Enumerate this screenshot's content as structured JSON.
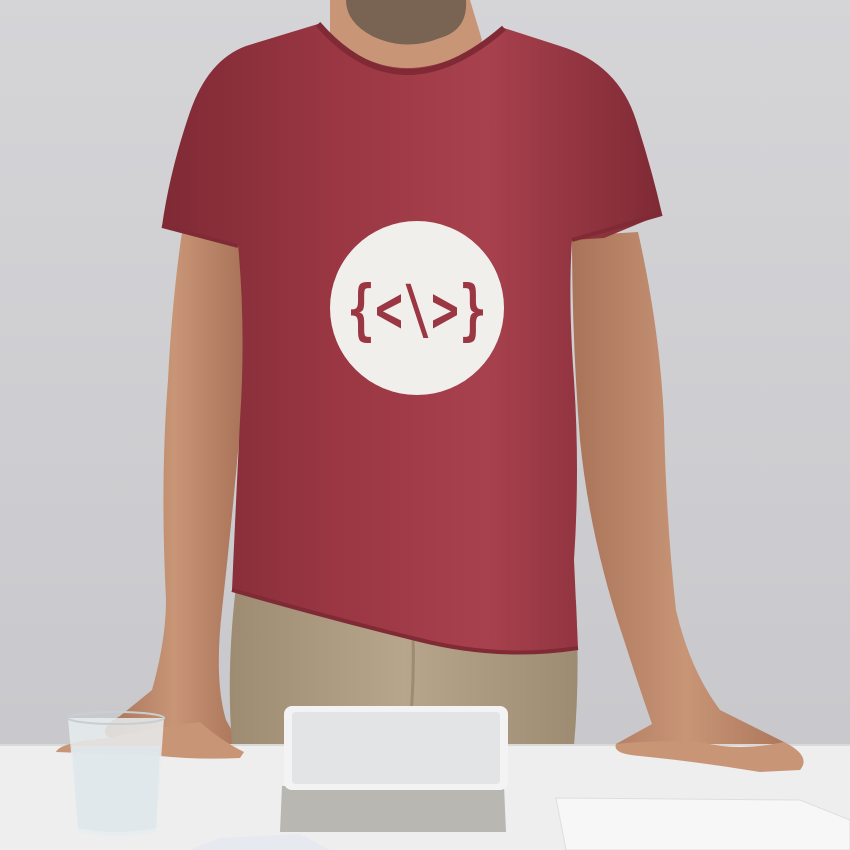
{
  "scene": {
    "description_free": true,
    "colors": {
      "background_top": "#d5d5d8",
      "background_bottom": "#c7c7cb",
      "shirt": "#9a3743",
      "shirt_shadow": "#7f2a35",
      "shirt_highlight": "#a7414d",
      "skin": "#c99577",
      "skin_shadow": "#a87358",
      "trousers": "#b7a58c",
      "trousers_shadow": "#9d8b72",
      "beard": "#6b5a4c",
      "logo_circle": "#f1efec",
      "logo_glyph": "#9a3743",
      "desk": "#eeeeee",
      "desk_edge": "#d9d9d9",
      "tablet": "#f3f3f4",
      "tablet_case": "#b9b7b2",
      "glass": "#e6ecef"
    },
    "logo": {
      "glyph": "{<\\>}"
    }
  }
}
